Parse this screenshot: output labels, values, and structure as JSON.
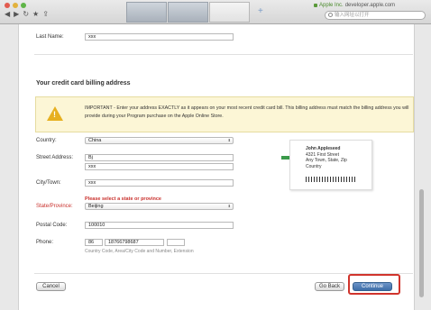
{
  "browser": {
    "site_name": "Apple Inc.",
    "site_domain": "developer.apple.com",
    "search_placeholder": "输入网址以打开"
  },
  "form": {
    "last_name": {
      "label": "Last Name:",
      "value": "xxx"
    },
    "section_title": "Your credit card billing address",
    "warning": "IMPORTANT - Enter your address EXACTLY as it appears on your most recent credit card bill. This billing address must match the billing address you will provide during your Program purchase on the Apple Online Store.",
    "country": {
      "label": "Country:",
      "value": "China"
    },
    "street": {
      "label": "Street Address:",
      "line1": "Bj",
      "line2": "xxx"
    },
    "city": {
      "label": "City/Town:",
      "value": "xxx"
    },
    "state": {
      "label": "State/Province:",
      "error": "Please select a state or province",
      "value": "Beijing"
    },
    "postal": {
      "label": "Postal Code:",
      "value": "100010"
    },
    "phone": {
      "label": "Phone:",
      "country_code": "86",
      "number": "18766798687",
      "hint": "Country Code, Area/City Code and Number, Extension"
    }
  },
  "sample_address": {
    "name": "John Appleseed",
    "line1": "4321 First Street",
    "line2": "Any Town, State, Zip",
    "line3": "Country"
  },
  "buttons": {
    "cancel": "Cancel",
    "go_back": "Go Back",
    "continue": "Continue"
  }
}
